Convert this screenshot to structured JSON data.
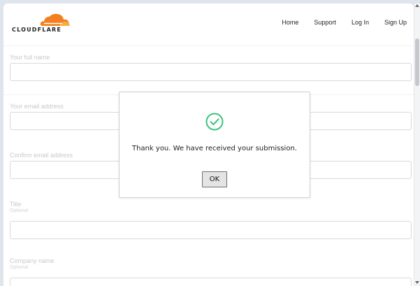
{
  "header": {
    "logo_text": "CLOUDFLARE",
    "brand_color": "#f38020",
    "nav": [
      {
        "label": "Home"
      },
      {
        "label": "Support"
      },
      {
        "label": "Log In"
      },
      {
        "label": "Sign Up"
      }
    ]
  },
  "form": {
    "fields": [
      {
        "label": "Your full name",
        "value": ""
      },
      {
        "label": "Your email address",
        "value": ""
      },
      {
        "label": "Confirm email address",
        "value": ""
      },
      {
        "label": "Title",
        "hint": "Optional",
        "value": ""
      },
      {
        "label": "Company name",
        "hint": "Optional",
        "value": ""
      }
    ]
  },
  "dialog": {
    "icon": "check-circle-icon",
    "icon_color": "#3cc47c",
    "message": "Thank you. We have received your submission.",
    "ok_label": "OK"
  }
}
